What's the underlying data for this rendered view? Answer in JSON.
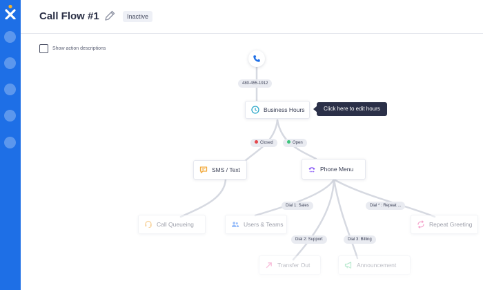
{
  "header": {
    "title": "Call Flow #1",
    "status_badge": "Inactive"
  },
  "options": {
    "show_descriptions_label": "Show action descriptions",
    "show_descriptions_checked": false
  },
  "flow": {
    "entry_number": "480-455-1912",
    "tooltip": "Click here to edit hours",
    "nodes": {
      "business_hours": "Business Hours",
      "sms_text": "SMS / Text",
      "phone_menu": "Phone Menu",
      "call_queueing": "Call Queueing",
      "users_teams": "Users & Teams",
      "repeat_greeting": "Repeat Greeting",
      "transfer_out": "Transfer Out",
      "announcement": "Announcement"
    },
    "branches": {
      "closed": "Closed",
      "open": "Open",
      "dial_1": "Dial 1: Sales",
      "dial_2": "Dial 2: Support",
      "dial_3": "Dial 3: Billing",
      "dial_star": "Dial * : Repeat ..."
    }
  },
  "colors": {
    "sidebar": "#1e6fe6",
    "closed_dot": "#e5484d",
    "open_dot": "#3cc47c",
    "tooltip_bg": "#2b3048",
    "business_hours_icon": "#2aa7c9",
    "sms_icon": "#f2a93b",
    "phone_menu_icon": "#8b5cf6",
    "call_queueing_icon": "#f2a93b",
    "users_teams_icon": "#3b82f6",
    "repeat_greeting_icon": "#ec4899",
    "transfer_out_icon": "#ec4899",
    "announcement_icon": "#3cc47c"
  }
}
